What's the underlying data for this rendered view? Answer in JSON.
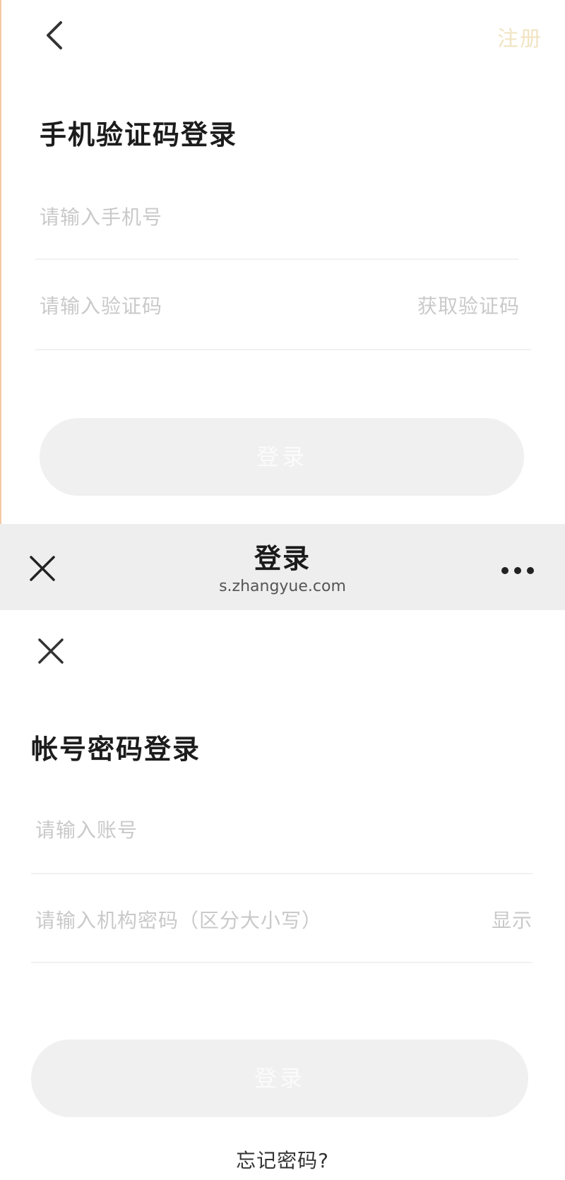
{
  "phone_login": {
    "register_label": "注册",
    "title": "手机验证码登录",
    "phone_placeholder": "请输入手机号",
    "code_placeholder": "请输入验证码",
    "get_code_label": "获取验证码",
    "login_button_label": "登录"
  },
  "webview_bar": {
    "title": "登录",
    "url": "s.zhangyue.com"
  },
  "account_login": {
    "title": "帐号密码登录",
    "account_placeholder": "请输入账号",
    "password_placeholder": "请输入机构密码（区分大小写）",
    "show_password_label": "显示",
    "login_button_label": "登录",
    "forgot_password_label": "忘记密码?"
  },
  "icons": {
    "back": "back-chevron-icon",
    "close": "close-icon",
    "more": "more-dots-icon"
  },
  "colors": {
    "register_link": "#f1e4c2",
    "placeholder_text": "#c9c9c9",
    "disabled_button": "#f0f0f0",
    "webview_bar": "#eeeeee"
  }
}
